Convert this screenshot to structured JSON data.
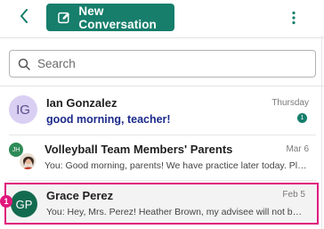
{
  "header": {
    "back_icon": "chevron-left-icon",
    "new_conversation_label": "New Conversation",
    "new_conversation_icon": "compose-icon",
    "more_icon": "kebab-menu-icon",
    "accent_color": "#167e6b"
  },
  "search": {
    "placeholder": "Search",
    "value": ""
  },
  "conversations": [
    {
      "avatar_initials": "IG",
      "name": "Ian Gonzalez",
      "date": "Thursday",
      "preview": "good morning, teacher!",
      "unread_count": "1"
    },
    {
      "avatar_initials": "JH",
      "name": "Volleyball Team Members' Parents",
      "date": "Mar 6",
      "preview": "You: Good morning, parents! We have practice later today. Pleas..."
    },
    {
      "avatar_initials": "GP",
      "name": "Grace Perez",
      "date": "Feb 5",
      "preview": "You: Hey, Mrs. Perez! Heather Brown, my advisee will not be co...",
      "highlight_marker": "1",
      "highlight_color": "#e0177c"
    }
  ]
}
